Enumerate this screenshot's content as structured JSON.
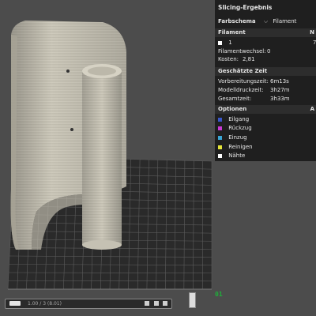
{
  "panel": {
    "title": "Slicing-Ergebnis",
    "color_scheme_label": "Farbschema",
    "color_scheme_value": "Filament",
    "filament_header": "Filament",
    "filament_header_right": "N",
    "filament_item": "1",
    "filament_item_extra": "7",
    "filament_changes_label": "Filamentwechsel:",
    "filament_changes_value": "0",
    "cost_label": "Kosten:",
    "cost_value": "2,81",
    "time_header": "Geschätzte Zeit",
    "prep_time_label": "Vorbereitungszeit:",
    "prep_time_value": "6m13s",
    "print_time_label": "Modelldruckzeit:",
    "print_time_value": "3h27m",
    "total_time_label": "Gesamtzeit:",
    "total_time_value": "3h33m",
    "options_header": "Optionen",
    "options_header_right": "A",
    "options": [
      {
        "label": "Eilgang",
        "color": "#3a57c9"
      },
      {
        "label": "Rückzug",
        "color": "#c93ad6"
      },
      {
        "label": "Einzug",
        "color": "#3aa6d6"
      },
      {
        "label": "Reinigen",
        "color": "#e6e63a"
      },
      {
        "label": "Nähte",
        "color": "#ffffff"
      }
    ]
  },
  "bottom": {
    "layer_range_text": "1.00 / 3 (8.01)",
    "layer_value": "01"
  },
  "colors": {
    "model": "#cfcbbd",
    "plate": "#2a2a2a",
    "grid": "#5c5c5c",
    "background": "#4c4c4c",
    "accent_green": "#1fae3a"
  }
}
